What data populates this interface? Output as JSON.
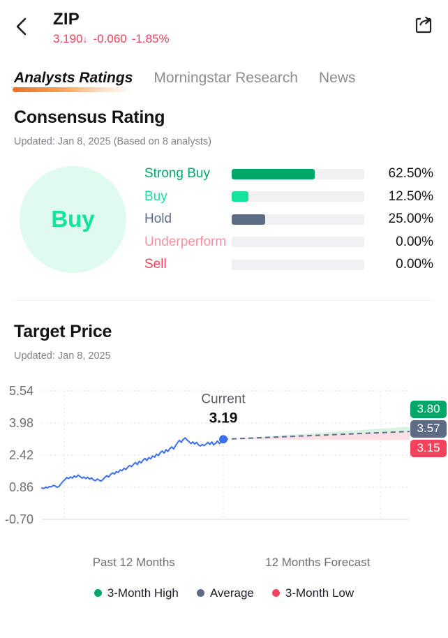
{
  "header": {
    "back_icon": "chevron-left-icon",
    "share_icon": "share-icon",
    "symbol": "ZIP",
    "price": "3.190",
    "direction_arrow": "↓",
    "change": "-0.060",
    "change_percent": "-1.85%",
    "negative_color": "#f04158"
  },
  "tabs": [
    {
      "label": "Analysts Ratings",
      "active": true
    },
    {
      "label": "Morningstar Research",
      "active": false
    },
    {
      "label": "News",
      "active": false
    }
  ],
  "consensus": {
    "title": "Consensus Rating",
    "updated": "Updated: Jan 8, 2025 (Based on  8 analysts)",
    "badge_label": "Buy",
    "badge_bg": "#dffaef",
    "badge_color": "#14e39a",
    "rows": [
      {
        "label": "Strong Buy",
        "percent": "62.50%",
        "value": 62.5,
        "color": "#00a868",
        "label_color": "#00a868"
      },
      {
        "label": "Buy",
        "percent": "12.50%",
        "value": 12.5,
        "color": "#14e39a",
        "label_color": "#14e39a"
      },
      {
        "label": "Hold",
        "percent": "25.00%",
        "value": 25.0,
        "color": "#5e6b85",
        "label_color": "#5e6b85"
      },
      {
        "label": "Underperform",
        "percent": "0.00%",
        "value": 0.0,
        "color": "#fa8fa0",
        "label_color": "#fa8fa0"
      },
      {
        "label": "Sell",
        "percent": "0.00%",
        "value": 0.0,
        "color": "#f4425c",
        "label_color": "#f4425c"
      }
    ]
  },
  "target_price": {
    "title": "Target Price",
    "updated": "Updated: Jan 8, 2025",
    "current_label": "Current",
    "current_value": "3.19",
    "badges": [
      {
        "value": "3.80",
        "bg": "#00a868",
        "name": "high-badge"
      },
      {
        "value": "3.57",
        "bg": "#5e6b85",
        "name": "average-badge"
      },
      {
        "value": "3.15",
        "bg": "#f4425c",
        "name": "low-badge"
      }
    ],
    "x_labels": [
      "Past 12 Months",
      "12 Months Forecast"
    ],
    "legend": [
      {
        "label": "3-Month High",
        "color": "#00a868"
      },
      {
        "label": "Average",
        "color": "#5e6b85"
      },
      {
        "label": "3-Month Low",
        "color": "#f4425c"
      }
    ]
  },
  "chart_data": {
    "type": "line",
    "title": "Target Price",
    "xlabel": "",
    "ylabel": "",
    "ylim": [
      -0.7,
      5.54
    ],
    "yticks": [
      5.54,
      3.98,
      2.42,
      0.86,
      -0.7
    ],
    "ytick_labels": [
      "5.54",
      "3.98",
      "2.42",
      "0.86",
      "-0.70"
    ],
    "grid": true,
    "legend_position": "bottom",
    "x_sections": [
      "Past 12 Months",
      "12 Months Forecast"
    ],
    "current": {
      "label": "Current",
      "value": 3.19
    },
    "forecast": {
      "high": 3.8,
      "average": 3.57,
      "low": 3.15
    },
    "series": [
      {
        "name": "Historical Price",
        "color": "#3b6ef0",
        "style": "solid",
        "values": [
          0.82,
          0.8,
          0.86,
          0.83,
          0.9,
          0.88,
          0.95,
          0.92,
          0.86,
          0.9,
          1.02,
          1.14,
          1.22,
          1.33,
          1.28,
          1.36,
          1.3,
          1.41,
          1.35,
          1.45,
          1.38,
          1.3,
          1.36,
          1.28,
          1.34,
          1.26,
          1.31,
          1.22,
          1.18,
          1.26,
          1.2,
          1.16,
          1.24,
          1.34,
          1.42,
          1.36,
          1.48,
          1.56,
          1.5,
          1.62,
          1.58,
          1.7,
          1.66,
          1.78,
          1.72,
          1.84,
          1.92,
          1.86,
          1.98,
          2.06,
          1.96,
          2.12,
          2.04,
          2.18,
          2.26,
          2.16,
          2.3,
          2.24,
          2.38,
          2.32,
          2.46,
          2.4,
          2.54,
          2.62,
          2.52,
          2.68,
          2.6,
          2.74,
          2.82,
          2.72,
          2.88,
          3.02,
          3.14,
          3.04,
          3.18,
          3.26,
          3.16,
          3.08,
          2.98,
          3.06,
          2.96,
          3.04,
          2.92,
          2.86,
          2.94,
          2.88,
          2.96,
          3.04,
          2.94,
          3.06,
          2.92,
          3.0,
          3.1,
          2.98,
          3.08,
          3.19
        ]
      },
      {
        "name": "Average Forecast",
        "color": "#5e6b85",
        "style": "dashed",
        "values": [
          3.19,
          3.57
        ]
      },
      {
        "name": "3-Month High Band",
        "color": "#d8f2e4",
        "style": "area",
        "values": [
          3.19,
          3.8
        ]
      },
      {
        "name": "3-Month Low Band",
        "color": "#fbdfe4",
        "style": "area",
        "values": [
          3.19,
          3.15
        ]
      }
    ]
  }
}
